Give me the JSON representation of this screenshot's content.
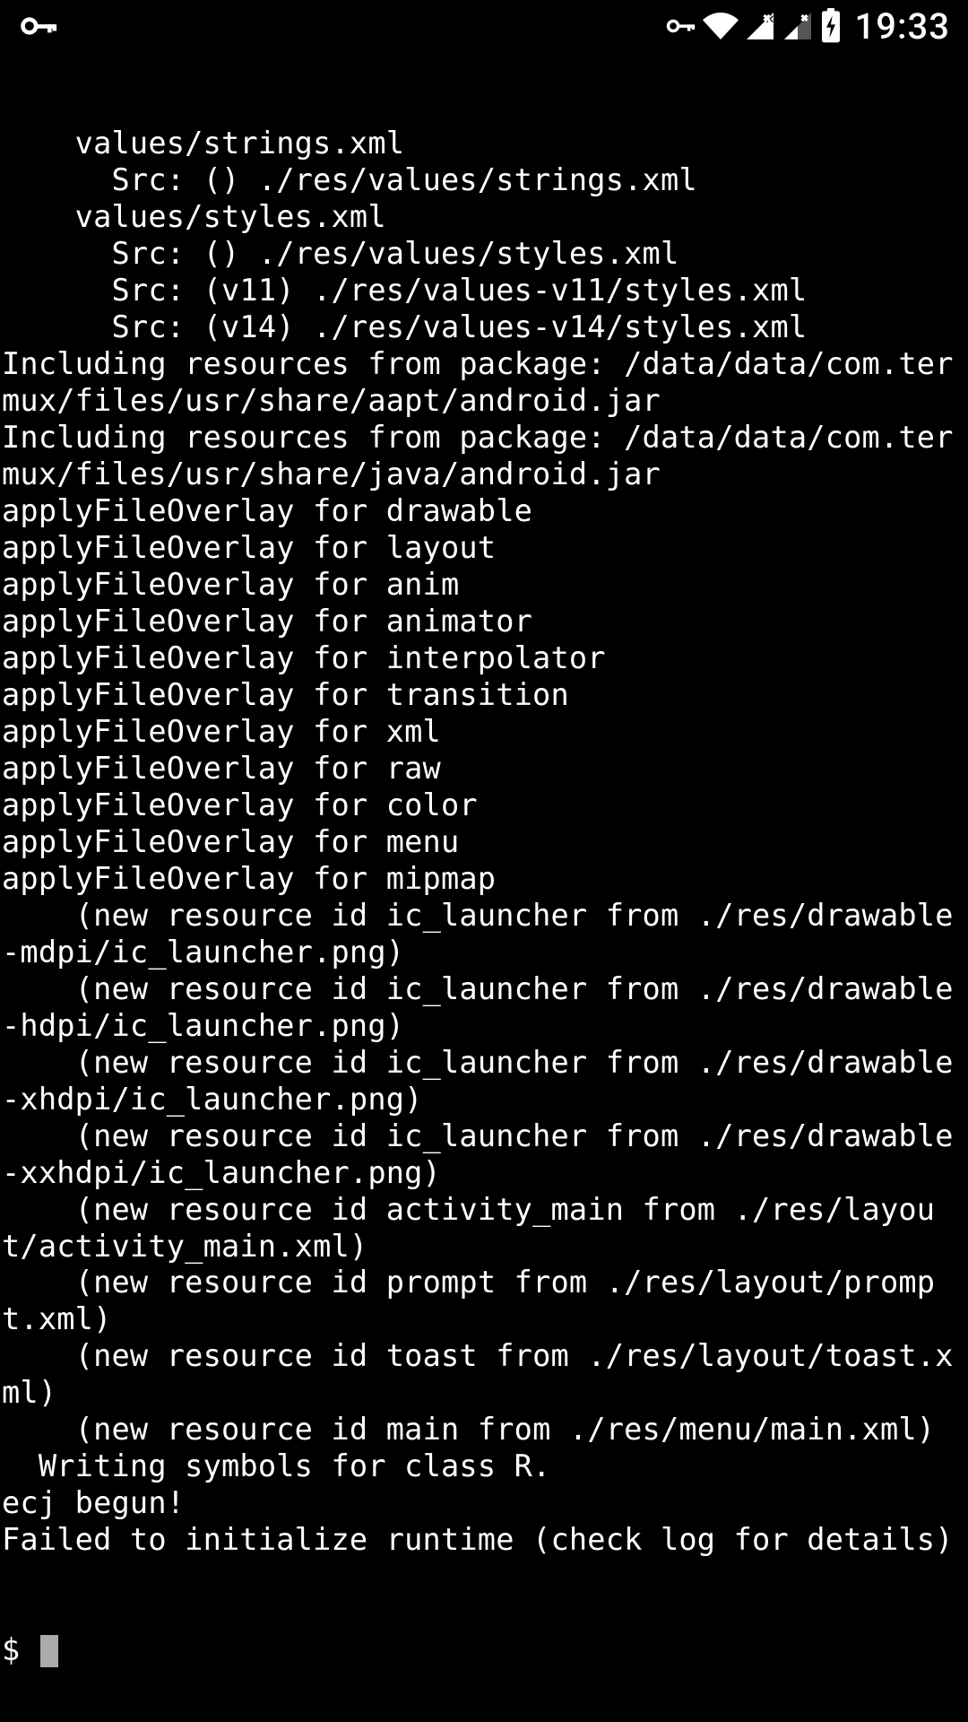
{
  "status_bar": {
    "time": "19:33"
  },
  "terminal": {
    "output": "    values/strings.xml\n      Src: () ./res/values/strings.xml\n    values/styles.xml\n      Src: () ./res/values/styles.xml\n      Src: (v11) ./res/values-v11/styles.xml\n      Src: (v14) ./res/values-v14/styles.xml\nIncluding resources from package: /data/data/com.termux/files/usr/share/aapt/android.jar\nIncluding resources from package: /data/data/com.termux/files/usr/share/java/android.jar\napplyFileOverlay for drawable\napplyFileOverlay for layout\napplyFileOverlay for anim\napplyFileOverlay for animator\napplyFileOverlay for interpolator\napplyFileOverlay for transition\napplyFileOverlay for xml\napplyFileOverlay for raw\napplyFileOverlay for color\napplyFileOverlay for menu\napplyFileOverlay for mipmap\n    (new resource id ic_launcher from ./res/drawable-mdpi/ic_launcher.png)\n    (new resource id ic_launcher from ./res/drawable-hdpi/ic_launcher.png)\n    (new resource id ic_launcher from ./res/drawable-xhdpi/ic_launcher.png)\n    (new resource id ic_launcher from ./res/drawable-xxhdpi/ic_launcher.png)\n    (new resource id activity_main from ./res/layout/activity_main.xml)\n    (new resource id prompt from ./res/layout/prompt.xml)\n    (new resource id toast from ./res/layout/toast.xml)\n    (new resource id main from ./res/menu/main.xml)\n  Writing symbols for class R.\necj begun!\nFailed to initialize runtime (check log for details)",
    "prompt": "$ "
  }
}
